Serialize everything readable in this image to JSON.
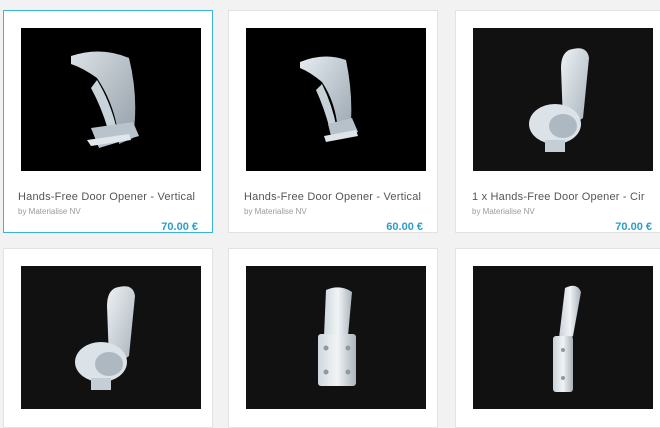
{
  "accent_color": "#3bb4d8",
  "products": [
    {
      "title": "Hands-Free Door Opener - Vertical",
      "author": "by Materialise NV",
      "price": "70.00 €",
      "image": "curved-wide-door-opener"
    },
    {
      "title": "Hands-Free Door Opener - Vertical",
      "author": "by Materialise NV",
      "price": "60.00 €",
      "image": "curved-narrow-door-opener"
    },
    {
      "title": "1 x Hands-Free Door Opener - Cir",
      "author": "by Materialise NV",
      "price": "70.00 €",
      "image": "hook-door-opener"
    },
    {
      "title": "",
      "author": "",
      "price": "",
      "image": "hook-door-opener"
    },
    {
      "title": "",
      "author": "",
      "price": "",
      "image": "flat-mount-door-opener"
    },
    {
      "title": "",
      "author": "",
      "price": "",
      "image": "slim-mount-door-opener"
    }
  ]
}
